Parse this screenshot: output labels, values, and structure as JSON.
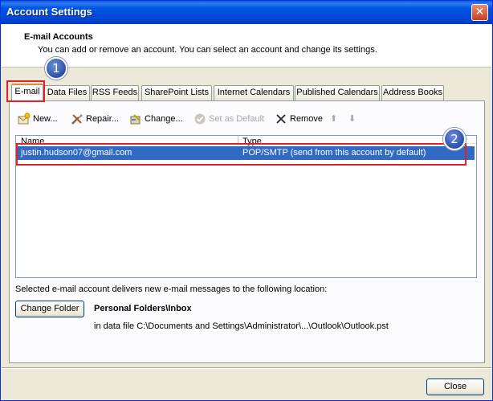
{
  "window": {
    "title": "Account Settings",
    "close_glyph": "✕"
  },
  "header": {
    "title": "E-mail Accounts",
    "subtitle": "You can add or remove an account. You can select an account and change its settings."
  },
  "tabs": [
    {
      "label": "E-mail"
    },
    {
      "label": "Data Files"
    },
    {
      "label": "RSS Feeds"
    },
    {
      "label": "SharePoint Lists"
    },
    {
      "label": "Internet Calendars"
    },
    {
      "label": "Published Calendars"
    },
    {
      "label": "Address Books"
    }
  ],
  "toolbar": {
    "new_label": "New...",
    "repair_label": "Repair...",
    "change_label": "Change...",
    "set_default_label": "Set as Default",
    "remove_label": "Remove",
    "up_glyph": "⬆",
    "down_glyph": "⬇"
  },
  "account_list": {
    "columns": [
      "Name",
      "Type"
    ],
    "rows": [
      {
        "name": "justin.hudson07@gmail.com",
        "type": "POP/SMTP (send from this account by default)"
      }
    ]
  },
  "callouts": {
    "one": "1",
    "two": "2"
  },
  "delivery": {
    "description": "Selected e-mail account delivers new e-mail messages to the following location:",
    "change_folder_label": "Change Folder",
    "folder": "Personal Folders\\Inbox",
    "data_file": "in data file C:\\Documents and Settings\\Administrator\\...\\Outlook\\Outlook.pst"
  },
  "footer": {
    "close_label": "Close"
  },
  "colors": {
    "title_bar": "#0055e5",
    "selection": "#316ac5",
    "highlight_border": "#e3202a",
    "active_tab_accent": "#e68b2c"
  }
}
